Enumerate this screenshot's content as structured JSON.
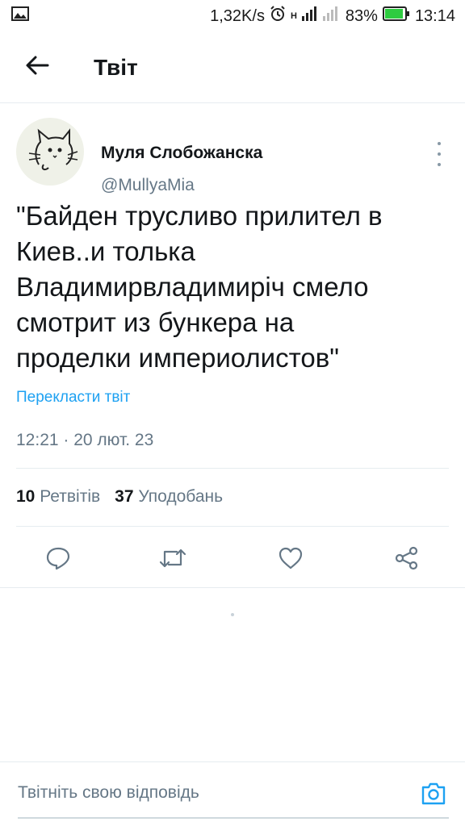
{
  "status_bar": {
    "speed": "1,32K/s",
    "network": "H",
    "battery_percent": "83%",
    "time": "13:14"
  },
  "header": {
    "title": "Твіт"
  },
  "tweet": {
    "author_name": "Муля Слобожанска",
    "author_handle": "@MullyaMia",
    "text_lines": [
      "\"Байден трусливо прилител в",
      "Киев..и толька",
      "Владимирвладимиріч смело",
      "смотрит из бункера на",
      "проделки империолистов\""
    ],
    "translate_label": "Перекласти твіт",
    "timestamp": "12:21 · 20 лют. 23",
    "retweets_count": "10",
    "retweets_label": "Ретвітів",
    "likes_count": "37",
    "likes_label": "Уподобань"
  },
  "reply": {
    "placeholder": "Твітніть свою відповідь"
  },
  "colors": {
    "accent": "#1da1f2",
    "secondary_text": "#657786",
    "divider": "#e6ecf0"
  },
  "icons": [
    "image-icon",
    "alarm-icon",
    "signal-icon",
    "battery-icon",
    "back-arrow-icon",
    "more-vertical-icon",
    "reply-icon",
    "retweet-icon",
    "like-icon",
    "share-icon",
    "camera-icon"
  ]
}
